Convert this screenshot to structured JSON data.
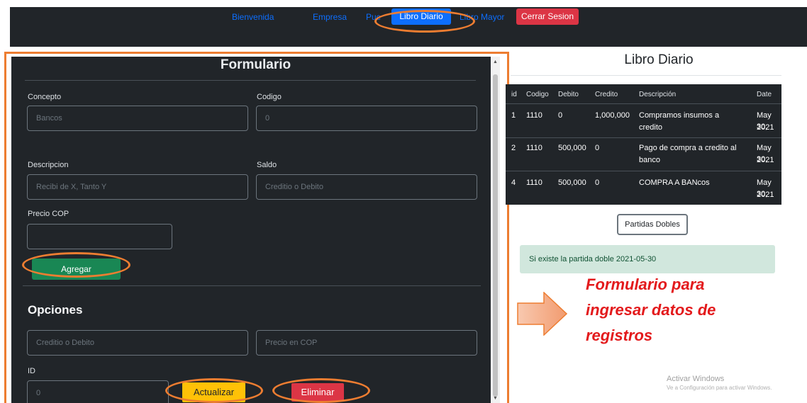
{
  "nav": {
    "items": [
      "Bienvenida",
      "Empresa",
      "Puc",
      "Libro Diario",
      "Libro Mayor"
    ],
    "logout": "Cerrar Sesion"
  },
  "form": {
    "title": "Formulario",
    "concepto_label": "Concepto",
    "concepto_placeholder": "Bancos",
    "codigo_label": "Codigo",
    "codigo_placeholder": "0",
    "descripcion_label": "Descripcion",
    "descripcion_placeholder": "Recibi de X, Tanto Y",
    "saldo_label": "Saldo",
    "saldo_placeholder": "Creditio o Debito",
    "precio_label": "Precio COP",
    "add_button": "Agregar"
  },
  "options": {
    "title": "Opciones",
    "type_placeholder": "Creditio o Debito",
    "price_placeholder": "Precio en COP",
    "id_label": "ID",
    "id_placeholder": "0",
    "update_button": "Actualizar",
    "delete_button": "Eliminar"
  },
  "journal": {
    "title": "Libro Diario",
    "columns": [
      "id",
      "Codigo",
      "Debito",
      "Credito",
      "Descripción",
      "Date"
    ],
    "rows": [
      {
        "id": "1",
        "codigo": "1110",
        "debito": "0",
        "credito": "1,000,000",
        "descripcion_1": "Compramos insumos a",
        "descripcion_2": "credito",
        "date_1": "May 30,",
        "date_2": "2021"
      },
      {
        "id": "2",
        "codigo": "1110",
        "debito": "500,000",
        "credito": "0",
        "descripcion_1": "Pago de compra a credito al",
        "descripcion_2": "banco",
        "date_1": "May 30,",
        "date_2": "2021"
      },
      {
        "id": "4",
        "codigo": "1110",
        "debito": "500,000",
        "credito": "0",
        "descripcion_1": "COMPRA A BANcos",
        "descripcion_2": "",
        "date_1": "May 30,",
        "date_2": "2021"
      }
    ],
    "double_entry_button": "Partidas Dobles",
    "alert": "Si existe la partida doble 2021-05-30"
  },
  "annotation": {
    "line1": "Formulario para",
    "line2": "ingresar datos de",
    "line3": "registros"
  },
  "watermark": {
    "line1": "Activar Windows",
    "line2": "Ve a Configuración para activar Windows."
  },
  "colors": {
    "annotation_orange": "#ed7d31",
    "annotation_red": "#e31a1c",
    "navbar_bg": "#212529",
    "primary": "#0d6efd",
    "success": "#198754",
    "warning": "#ffc107",
    "danger": "#dc3545"
  }
}
